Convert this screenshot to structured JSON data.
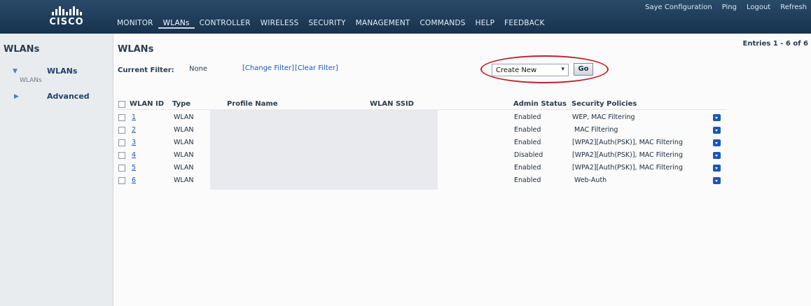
{
  "brand": {
    "wordmark": "CISCO"
  },
  "top_links": [
    "Saye Configuration",
    "Ping",
    "Logout",
    "Refresh"
  ],
  "menu": [
    "MONITOR",
    "WLANs",
    "CONTROLLER",
    "WIRELESS",
    "SECURITY",
    "MANAGEMENT",
    "COMMANDS",
    "HELP",
    "FEEDBACK"
  ],
  "sidebar": {
    "title": "WLANs",
    "items": [
      {
        "label": "WLANs",
        "sub": "WLANs"
      },
      {
        "label": "Advanced"
      }
    ]
  },
  "page": {
    "title": "WLANs",
    "entries": "Entries 1 - 6 of 6",
    "filter_label": "Current Filter:",
    "filter_value": "None",
    "change_filter": "[Change Filter]",
    "clear_filter": "[Clear Filter]",
    "create_select": "Create New",
    "go": "Go"
  },
  "table": {
    "headers": [
      "WLAN ID",
      "Type",
      "Profile Name",
      "WLAN SSID",
      "Admin Status",
      "Security Policies"
    ],
    "rows": [
      {
        "id": "1",
        "type": "WLAN",
        "status": "Enabled",
        "security": "WEP, MAC Filtering"
      },
      {
        "id": "2",
        "type": "WLAN",
        "status": "Enabled",
        "security": "MAC Filtering"
      },
      {
        "id": "3",
        "type": "WLAN",
        "status": "Enabled",
        "security": "[WPA2][Auth(PSK)], MAC Filtering"
      },
      {
        "id": "4",
        "type": "WLAN",
        "status": "Disabled",
        "security": "[WPA2][Auth(PSK)], MAC Filtering"
      },
      {
        "id": "5",
        "type": "WLAN",
        "status": "Enabled",
        "security": "[WPA2][Auth(PSK)], MAC Filtering"
      },
      {
        "id": "6",
        "type": "WLAN",
        "status": "Enabled",
        "security": "Web-Auth"
      }
    ]
  }
}
